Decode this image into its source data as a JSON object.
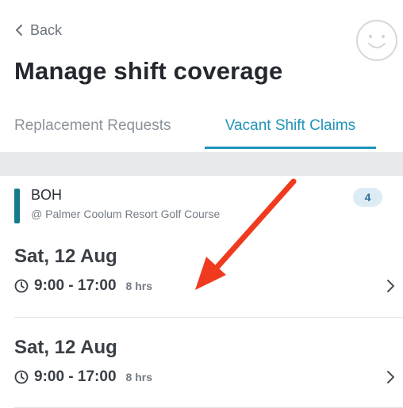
{
  "header": {
    "back_label": "Back",
    "title": "Manage shift coverage"
  },
  "tabs": [
    {
      "label": "Replacement Requests",
      "active": false
    },
    {
      "label": "Vacant Shift Claims",
      "active": true
    }
  ],
  "group": {
    "name": "BOH",
    "location": "@ Palmer Coolum Resort Golf Course",
    "count": "4",
    "color": "#167a8b"
  },
  "shifts": [
    {
      "date": "Sat, 12 Aug",
      "time": "9:00 - 17:00",
      "hours": "8 hrs"
    },
    {
      "date": "Sat, 12 Aug",
      "time": "9:00 - 17:00",
      "hours": "8 hrs"
    }
  ],
  "colors": {
    "accent": "#1f93b9",
    "annotation_arrow": "#f03a1f"
  },
  "icons": {
    "back": "chevron-left-icon",
    "avatar": "smiley-face-icon",
    "clock": "clock-icon",
    "row_chevron": "chevron-right-icon"
  }
}
